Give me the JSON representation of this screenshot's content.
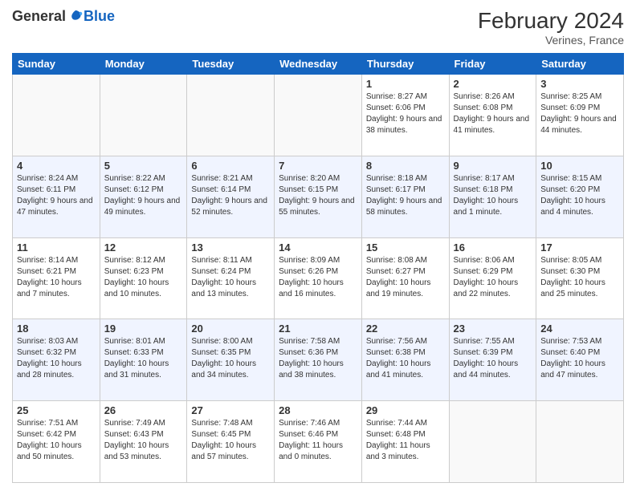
{
  "header": {
    "logo_general": "General",
    "logo_blue": "Blue",
    "month_title": "February 2024",
    "location": "Verines, France"
  },
  "days_of_week": [
    "Sunday",
    "Monday",
    "Tuesday",
    "Wednesday",
    "Thursday",
    "Friday",
    "Saturday"
  ],
  "weeks": [
    [
      {
        "day": "",
        "info": ""
      },
      {
        "day": "",
        "info": ""
      },
      {
        "day": "",
        "info": ""
      },
      {
        "day": "",
        "info": ""
      },
      {
        "day": "1",
        "info": "Sunrise: 8:27 AM\nSunset: 6:06 PM\nDaylight: 9 hours and 38 minutes."
      },
      {
        "day": "2",
        "info": "Sunrise: 8:26 AM\nSunset: 6:08 PM\nDaylight: 9 hours and 41 minutes."
      },
      {
        "day": "3",
        "info": "Sunrise: 8:25 AM\nSunset: 6:09 PM\nDaylight: 9 hours and 44 minutes."
      }
    ],
    [
      {
        "day": "4",
        "info": "Sunrise: 8:24 AM\nSunset: 6:11 PM\nDaylight: 9 hours and 47 minutes."
      },
      {
        "day": "5",
        "info": "Sunrise: 8:22 AM\nSunset: 6:12 PM\nDaylight: 9 hours and 49 minutes."
      },
      {
        "day": "6",
        "info": "Sunrise: 8:21 AM\nSunset: 6:14 PM\nDaylight: 9 hours and 52 minutes."
      },
      {
        "day": "7",
        "info": "Sunrise: 8:20 AM\nSunset: 6:15 PM\nDaylight: 9 hours and 55 minutes."
      },
      {
        "day": "8",
        "info": "Sunrise: 8:18 AM\nSunset: 6:17 PM\nDaylight: 9 hours and 58 minutes."
      },
      {
        "day": "9",
        "info": "Sunrise: 8:17 AM\nSunset: 6:18 PM\nDaylight: 10 hours and 1 minute."
      },
      {
        "day": "10",
        "info": "Sunrise: 8:15 AM\nSunset: 6:20 PM\nDaylight: 10 hours and 4 minutes."
      }
    ],
    [
      {
        "day": "11",
        "info": "Sunrise: 8:14 AM\nSunset: 6:21 PM\nDaylight: 10 hours and 7 minutes."
      },
      {
        "day": "12",
        "info": "Sunrise: 8:12 AM\nSunset: 6:23 PM\nDaylight: 10 hours and 10 minutes."
      },
      {
        "day": "13",
        "info": "Sunrise: 8:11 AM\nSunset: 6:24 PM\nDaylight: 10 hours and 13 minutes."
      },
      {
        "day": "14",
        "info": "Sunrise: 8:09 AM\nSunset: 6:26 PM\nDaylight: 10 hours and 16 minutes."
      },
      {
        "day": "15",
        "info": "Sunrise: 8:08 AM\nSunset: 6:27 PM\nDaylight: 10 hours and 19 minutes."
      },
      {
        "day": "16",
        "info": "Sunrise: 8:06 AM\nSunset: 6:29 PM\nDaylight: 10 hours and 22 minutes."
      },
      {
        "day": "17",
        "info": "Sunrise: 8:05 AM\nSunset: 6:30 PM\nDaylight: 10 hours and 25 minutes."
      }
    ],
    [
      {
        "day": "18",
        "info": "Sunrise: 8:03 AM\nSunset: 6:32 PM\nDaylight: 10 hours and 28 minutes."
      },
      {
        "day": "19",
        "info": "Sunrise: 8:01 AM\nSunset: 6:33 PM\nDaylight: 10 hours and 31 minutes."
      },
      {
        "day": "20",
        "info": "Sunrise: 8:00 AM\nSunset: 6:35 PM\nDaylight: 10 hours and 34 minutes."
      },
      {
        "day": "21",
        "info": "Sunrise: 7:58 AM\nSunset: 6:36 PM\nDaylight: 10 hours and 38 minutes."
      },
      {
        "day": "22",
        "info": "Sunrise: 7:56 AM\nSunset: 6:38 PM\nDaylight: 10 hours and 41 minutes."
      },
      {
        "day": "23",
        "info": "Sunrise: 7:55 AM\nSunset: 6:39 PM\nDaylight: 10 hours and 44 minutes."
      },
      {
        "day": "24",
        "info": "Sunrise: 7:53 AM\nSunset: 6:40 PM\nDaylight: 10 hours and 47 minutes."
      }
    ],
    [
      {
        "day": "25",
        "info": "Sunrise: 7:51 AM\nSunset: 6:42 PM\nDaylight: 10 hours and 50 minutes."
      },
      {
        "day": "26",
        "info": "Sunrise: 7:49 AM\nSunset: 6:43 PM\nDaylight: 10 hours and 53 minutes."
      },
      {
        "day": "27",
        "info": "Sunrise: 7:48 AM\nSunset: 6:45 PM\nDaylight: 10 hours and 57 minutes."
      },
      {
        "day": "28",
        "info": "Sunrise: 7:46 AM\nSunset: 6:46 PM\nDaylight: 11 hours and 0 minutes."
      },
      {
        "day": "29",
        "info": "Sunrise: 7:44 AM\nSunset: 6:48 PM\nDaylight: 11 hours and 3 minutes."
      },
      {
        "day": "",
        "info": ""
      },
      {
        "day": "",
        "info": ""
      }
    ]
  ],
  "colors": {
    "header_bg": "#1565C0",
    "shaded_row": "#f0f4ff"
  }
}
